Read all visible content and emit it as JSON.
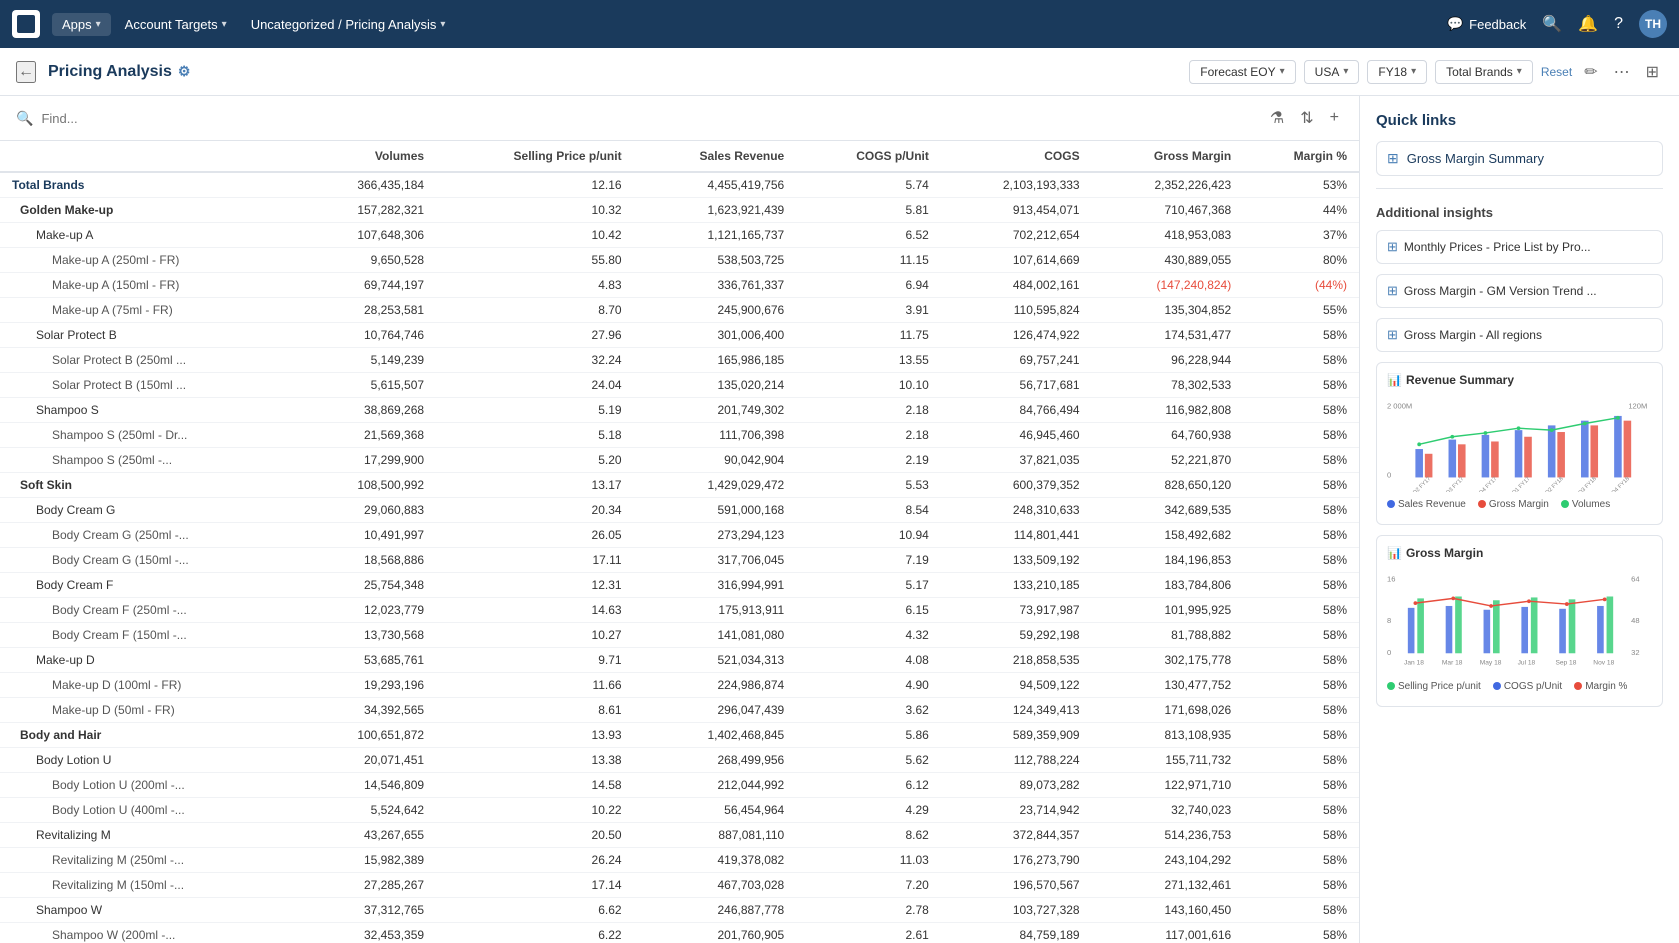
{
  "nav": {
    "logo_alt": "Anaplan",
    "apps_label": "Apps",
    "account_targets_label": "Account Targets",
    "current_page_label": "Uncategorized / Pricing Analysis",
    "feedback_label": "Feedback",
    "search_icon": "🔍",
    "bell_icon": "🔔",
    "help_icon": "?",
    "avatar_initials": "TH"
  },
  "subheader": {
    "back_icon": "←",
    "page_title": "Pricing Analysis",
    "settings_icon": "⚙",
    "filters": [
      {
        "id": "forecast",
        "label": "Forecast EOY"
      },
      {
        "id": "region",
        "label": "USA"
      },
      {
        "id": "year",
        "label": "FY18"
      },
      {
        "id": "brands",
        "label": "Total Brands"
      }
    ],
    "reset_label": "Reset",
    "edit_icon": "✏",
    "more_icon": "⋯",
    "expand_icon": "⊞"
  },
  "table": {
    "search_placeholder": "Find...",
    "columns": [
      "Volumes",
      "Selling Price p/unit",
      "Sales Revenue",
      "COGS p/Unit",
      "COGS",
      "Gross Margin",
      "Margin %"
    ],
    "rows": [
      {
        "level": 0,
        "name": "Total Brands",
        "values": [
          "366,435,184",
          "12.16",
          "4,455,419,756",
          "5.74",
          "2,103,193,333",
          "2,352,226,423",
          "53%"
        ]
      },
      {
        "level": 1,
        "name": "Golden Make-up",
        "values": [
          "157,282,321",
          "10.32",
          "1,623,921,439",
          "5.81",
          "913,454,071",
          "710,467,368",
          "44%"
        ]
      },
      {
        "level": 2,
        "name": "Make-up A",
        "values": [
          "107,648,306",
          "10.42",
          "1,121,165,737",
          "6.52",
          "702,212,654",
          "418,953,083",
          "37%"
        ]
      },
      {
        "level": 3,
        "name": "Make-up A (250ml - FR)",
        "values": [
          "9,650,528",
          "55.80",
          "538,503,725",
          "11.15",
          "107,614,669",
          "430,889,055",
          "80%"
        ]
      },
      {
        "level": 3,
        "name": "Make-up A (150ml - FR)",
        "values": [
          "69,744,197",
          "4.83",
          "336,761,337",
          "6.94",
          "484,002,161",
          "(147,240,824)",
          "(44%)"
        ],
        "negative": [
          5,
          6
        ]
      },
      {
        "level": 3,
        "name": "Make-up A (75ml - FR)",
        "values": [
          "28,253,581",
          "8.70",
          "245,900,676",
          "3.91",
          "110,595,824",
          "135,304,852",
          "55%"
        ]
      },
      {
        "level": 2,
        "name": "Solar Protect B",
        "values": [
          "10,764,746",
          "27.96",
          "301,006,400",
          "11.75",
          "126,474,922",
          "174,531,477",
          "58%"
        ]
      },
      {
        "level": 3,
        "name": "Solar Protect B (250ml ...",
        "values": [
          "5,149,239",
          "32.24",
          "165,986,185",
          "13.55",
          "69,757,241",
          "96,228,944",
          "58%"
        ]
      },
      {
        "level": 3,
        "name": "Solar Protect B (150ml ...",
        "values": [
          "5,615,507",
          "24.04",
          "135,020,214",
          "10.10",
          "56,717,681",
          "78,302,533",
          "58%"
        ]
      },
      {
        "level": 2,
        "name": "Shampoo S",
        "values": [
          "38,869,268",
          "5.19",
          "201,749,302",
          "2.18",
          "84,766,494",
          "116,982,808",
          "58%"
        ]
      },
      {
        "level": 3,
        "name": "Shampoo S (250ml - Dr...",
        "values": [
          "21,569,368",
          "5.18",
          "111,706,398",
          "2.18",
          "46,945,460",
          "64,760,938",
          "58%"
        ]
      },
      {
        "level": 3,
        "name": "Shampoo S (250ml -...",
        "values": [
          "17,299,900",
          "5.20",
          "90,042,904",
          "2.19",
          "37,821,035",
          "52,221,870",
          "58%"
        ]
      },
      {
        "level": 1,
        "name": "Soft Skin",
        "values": [
          "108,500,992",
          "13.17",
          "1,429,029,472",
          "5.53",
          "600,379,352",
          "828,650,120",
          "58%"
        ]
      },
      {
        "level": 2,
        "name": "Body Cream G",
        "values": [
          "29,060,883",
          "20.34",
          "591,000,168",
          "8.54",
          "248,310,633",
          "342,689,535",
          "58%"
        ]
      },
      {
        "level": 3,
        "name": "Body Cream G (250ml -...",
        "values": [
          "10,491,997",
          "26.05",
          "273,294,123",
          "10.94",
          "114,801,441",
          "158,492,682",
          "58%"
        ]
      },
      {
        "level": 3,
        "name": "Body Cream G (150ml -...",
        "values": [
          "18,568,886",
          "17.11",
          "317,706,045",
          "7.19",
          "133,509,192",
          "184,196,853",
          "58%"
        ]
      },
      {
        "level": 2,
        "name": "Body Cream F",
        "values": [
          "25,754,348",
          "12.31",
          "316,994,991",
          "5.17",
          "133,210,185",
          "183,784,806",
          "58%"
        ]
      },
      {
        "level": 3,
        "name": "Body Cream F (250ml -...",
        "values": [
          "12,023,779",
          "14.63",
          "175,913,911",
          "6.15",
          "73,917,987",
          "101,995,925",
          "58%"
        ]
      },
      {
        "level": 3,
        "name": "Body Cream F (150ml -...",
        "values": [
          "13,730,568",
          "10.27",
          "141,081,080",
          "4.32",
          "59,292,198",
          "81,788,882",
          "58%"
        ]
      },
      {
        "level": 2,
        "name": "Make-up D",
        "values": [
          "53,685,761",
          "9.71",
          "521,034,313",
          "4.08",
          "218,858,535",
          "302,175,778",
          "58%"
        ]
      },
      {
        "level": 3,
        "name": "Make-up D (100ml - FR)",
        "values": [
          "19,293,196",
          "11.66",
          "224,986,874",
          "4.90",
          "94,509,122",
          "130,477,752",
          "58%"
        ]
      },
      {
        "level": 3,
        "name": "Make-up D (50ml - FR)",
        "values": [
          "34,392,565",
          "8.61",
          "296,047,439",
          "3.62",
          "124,349,413",
          "171,698,026",
          "58%"
        ]
      },
      {
        "level": 1,
        "name": "Body and Hair",
        "values": [
          "100,651,872",
          "13.93",
          "1,402,468,845",
          "5.86",
          "589,359,909",
          "813,108,935",
          "58%"
        ]
      },
      {
        "level": 2,
        "name": "Body Lotion U",
        "values": [
          "20,071,451",
          "13.38",
          "268,499,956",
          "5.62",
          "112,788,224",
          "155,711,732",
          "58%"
        ]
      },
      {
        "level": 3,
        "name": "Body Lotion U (200ml -...",
        "values": [
          "14,546,809",
          "14.58",
          "212,044,992",
          "6.12",
          "89,073,282",
          "122,971,710",
          "58%"
        ]
      },
      {
        "level": 3,
        "name": "Body Lotion U (400ml -...",
        "values": [
          "5,524,642",
          "10.22",
          "56,454,964",
          "4.29",
          "23,714,942",
          "32,740,023",
          "58%"
        ]
      },
      {
        "level": 2,
        "name": "Revitalizing M",
        "values": [
          "43,267,655",
          "20.50",
          "887,081,110",
          "8.62",
          "372,844,357",
          "514,236,753",
          "58%"
        ]
      },
      {
        "level": 3,
        "name": "Revitalizing M (250ml -...",
        "values": [
          "15,982,389",
          "26.24",
          "419,378,082",
          "11.03",
          "176,273,790",
          "243,104,292",
          "58%"
        ]
      },
      {
        "level": 3,
        "name": "Revitalizing M (150ml -...",
        "values": [
          "27,285,267",
          "17.14",
          "467,703,028",
          "7.20",
          "196,570,567",
          "271,132,461",
          "58%"
        ]
      },
      {
        "level": 2,
        "name": "Shampoo W",
        "values": [
          "37,312,765",
          "6.62",
          "246,887,778",
          "2.78",
          "103,727,328",
          "143,160,450",
          "58%"
        ]
      },
      {
        "level": 3,
        "name": "Shampoo W (200ml -...",
        "values": [
          "32,453,359",
          "6.22",
          "201,760,905",
          "2.61",
          "84,759,189",
          "117,001,616",
          "58%"
        ]
      }
    ]
  },
  "right_panel": {
    "quick_links_title": "Quick links",
    "quick_links": [
      {
        "id": "gross-margin-summary",
        "label": "Gross Margin Summary",
        "icon": "⊞"
      }
    ],
    "additional_insights_title": "Additional insights",
    "insights": [
      {
        "id": "monthly-prices",
        "label": "Monthly Prices - Price List by Pro...",
        "icon": "⊞"
      },
      {
        "id": "gm-version-trend",
        "label": "Gross Margin - GM Version Trend ...",
        "icon": "⊞"
      },
      {
        "id": "gm-all-regions",
        "label": "Gross Margin - All regions",
        "icon": "⊞"
      }
    ],
    "revenue_summary_title": "Revenue Summary",
    "revenue_chart": {
      "x_labels": [
        "Q2 FY17",
        "Q3 FY17",
        "Q4 FY17",
        "Q1 FY17",
        "Q2 FY18",
        "Q3 FY18",
        "Q4 FY18"
      ],
      "y_left_max": "2 000M",
      "y_right_max": "120M",
      "legend": [
        {
          "label": "Sales Revenue",
          "color": "#4169e1"
        },
        {
          "label": "Gross Margin",
          "color": "#e74c3c"
        },
        {
          "label": "Volumes",
          "color": "#2ecc71"
        }
      ]
    },
    "gm_chart_title": "Gross Margin",
    "gm_chart": {
      "y_left_max": "16",
      "y_right_max": "64",
      "y_left_mid": "8",
      "y_right_mid": "48",
      "x_labels": [
        "Jan 18",
        "Mar 18",
        "May 18",
        "Jul 18",
        "Sep 18",
        "Nov 18"
      ],
      "legend": [
        {
          "label": "Selling Price p/unit",
          "color": "#2ecc71"
        },
        {
          "label": "COGS p/Unit",
          "color": "#4169e1"
        },
        {
          "label": "Margin %",
          "color": "#e74c3c"
        }
      ]
    }
  }
}
